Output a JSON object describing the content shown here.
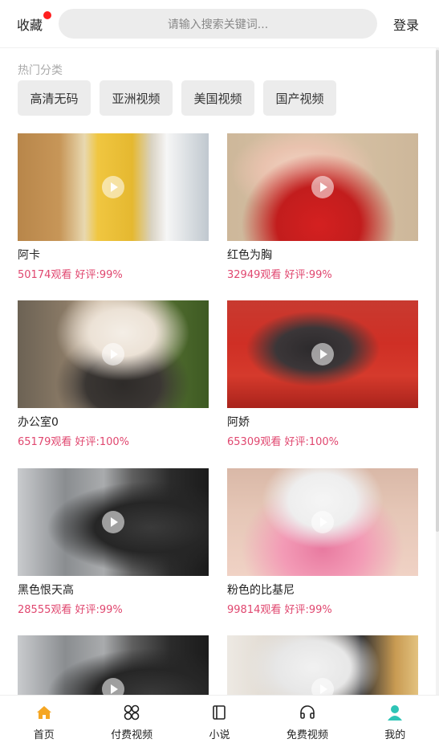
{
  "header": {
    "favorites_label": "收藏",
    "search_placeholder": "请输入搜索关键词...",
    "login_label": "登录",
    "badge_color": "#ff1f1f"
  },
  "categories": {
    "title": "热门分类",
    "items": [
      "高清无码",
      "亚洲视频",
      "美国视频",
      "国产视频"
    ]
  },
  "videos": [
    {
      "title": "阿卡",
      "stats": "50174观看 好评:99%"
    },
    {
      "title": "红色为胸",
      "stats": "32949观看 好评:99%"
    },
    {
      "title": "办公室0",
      "stats": "65179观看 好评:100%"
    },
    {
      "title": "阿娇",
      "stats": "65309观看 好评:100%"
    },
    {
      "title": "黑色恨天高",
      "stats": "28555观看 好评:99%"
    },
    {
      "title": "粉色的比基尼",
      "stats": "99814观看 好评:99%"
    },
    {
      "title": "",
      "stats": ""
    },
    {
      "title": "",
      "stats": ""
    }
  ],
  "nav": {
    "items": [
      {
        "label": "首页",
        "icon": "home-icon",
        "active": true
      },
      {
        "label": "付费视频",
        "icon": "grid-icon"
      },
      {
        "label": "小说",
        "icon": "book-icon"
      },
      {
        "label": "免费视频",
        "icon": "headphones-icon"
      },
      {
        "label": "我的",
        "icon": "user-icon"
      }
    ],
    "accent_home": "#f5a623",
    "accent_user": "#2ec4b6"
  },
  "colors": {
    "stats_text": "#e0476f",
    "chip_bg": "#ececec"
  }
}
